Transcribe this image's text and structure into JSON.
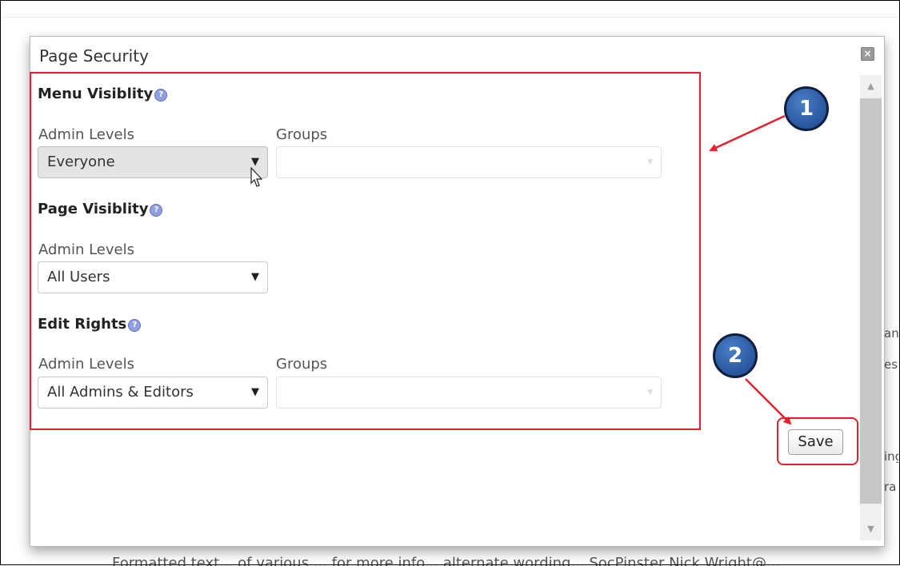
{
  "dialog": {
    "title": "Page Security",
    "close_icon": "close-icon"
  },
  "menu_visibility": {
    "heading": "Menu Visiblity",
    "help_glyph": "?",
    "admin_levels_label": "Admin Levels",
    "admin_levels_value": "Everyone",
    "groups_label": "Groups",
    "groups_value": ""
  },
  "page_visibility": {
    "heading": "Page Visiblity",
    "help_glyph": "?",
    "admin_levels_label": "Admin Levels",
    "admin_levels_value": "All Users"
  },
  "edit_rights": {
    "heading": "Edit Rights",
    "help_glyph": "?",
    "admin_levels_label": "Admin Levels",
    "admin_levels_value": "All Admins & Editors",
    "groups_label": "Groups",
    "groups_value": ""
  },
  "save_label": "Save",
  "annotations": {
    "marker_1": "1",
    "marker_2": "2"
  },
  "background_snippets": [
    "ang",
    "es",
    "ing",
    "ra"
  ],
  "background_bottom_text": "Formatted text... of various ... for more info... alternate wording... SocPinster Nick Wright@...",
  "colors": {
    "annotation_red": "#e8202e",
    "marker_blue": "#2e5ea7",
    "help_icon_blue": "#8f9fe0"
  }
}
